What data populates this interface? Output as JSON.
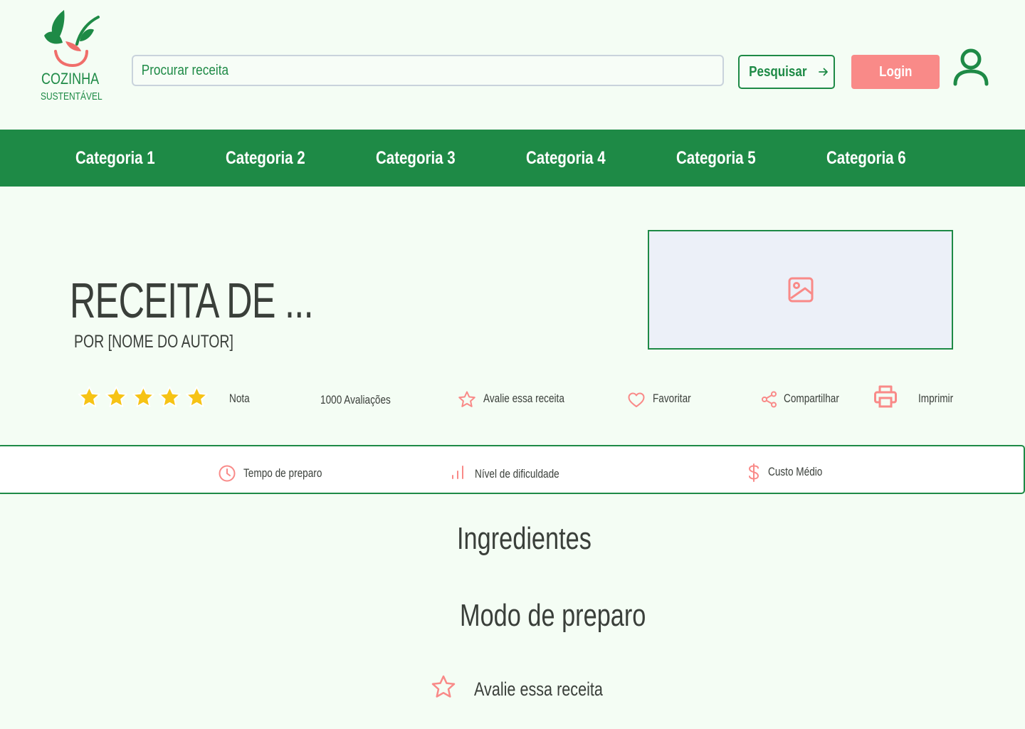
{
  "brand": {
    "line1": "COZINHA",
    "line2": "SUSTENTÁVEL",
    "colors": {
      "primary": "#1e8a46",
      "accent": "#f98a88",
      "background": "#f4fdf4"
    }
  },
  "header": {
    "search_placeholder": "Procurar receita",
    "search_button": "Pesquisar",
    "login_button": "Login"
  },
  "nav": {
    "items": [
      {
        "label": "Categoria 1"
      },
      {
        "label": "Categoria 2"
      },
      {
        "label": "Categoria 3"
      },
      {
        "label": "Categoria 4"
      },
      {
        "label": "Categoria 5"
      },
      {
        "label": "Categoria 6"
      }
    ]
  },
  "recipe": {
    "title": "RECEITA DE ...",
    "author": "POR [NOME DO AUTOR]",
    "rating_stars": 5,
    "rating_label": "Nota",
    "reviews": "1000 Avaliações",
    "actions": {
      "rate": "Avalie essa receita",
      "favorite": "Favoritar",
      "share": "Compartilhar",
      "print": "Imprimir"
    }
  },
  "info": {
    "prep_time": "Tempo de preparo",
    "difficulty": "Nível de dificuldade",
    "cost": "Custo Médio"
  },
  "sections": {
    "ingredients": "Ingredientes",
    "method": "Modo de preparo",
    "rate_bottom": "Avalie essa receita"
  }
}
